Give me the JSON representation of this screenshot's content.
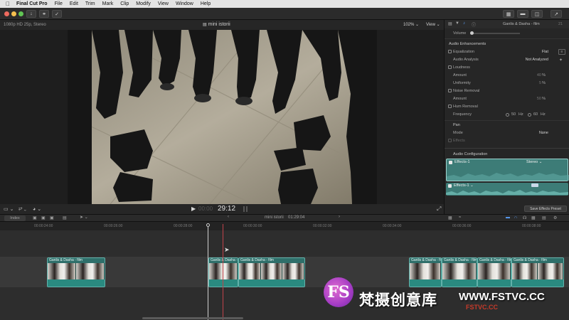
{
  "menubar": {
    "apple": "",
    "items": [
      "Final Cut Pro",
      "File",
      "Edit",
      "Trim",
      "Mark",
      "Clip",
      "Modify",
      "View",
      "Window",
      "Help"
    ]
  },
  "viewer": {
    "format": "1080p HD 25p, Stereo",
    "title": "mini istorii",
    "zoom": "102%",
    "view_label": "View",
    "timecode": "29:12",
    "timecode_prefix": "00:00"
  },
  "inspector": {
    "clip_title": "Ganlis & Dasha - film",
    "clip_duration": "21",
    "volume_label": "Volume",
    "audio_enhancements": "Audio Enhancements",
    "equalization": {
      "label": "Equalization",
      "value": "Flat"
    },
    "audio_analysis": {
      "label": "Audio Analysis",
      "value": "Not Analyzed"
    },
    "loudness": "Loudness",
    "amount": {
      "label": "Amount",
      "value": "40",
      "unit": "%"
    },
    "uniformity": {
      "label": "Uniformity",
      "value": "5",
      "unit": "%"
    },
    "noise_removal": "Noise Removal",
    "noise_amount": {
      "label": "Amount",
      "value": "50",
      "unit": "%"
    },
    "hum_removal": "Hum Removal",
    "frequency": {
      "label": "Frequency",
      "opt1": "50",
      "opt2": "60",
      "unit": "Hz"
    },
    "pan": "Pan",
    "mode": {
      "label": "Mode",
      "value": "None"
    },
    "effects": "Effects",
    "audio_config": "Audio Configuration",
    "config_row1": {
      "label": "Effects-1",
      "value": "Stereo"
    },
    "config_row2": {
      "label": "Effects-1"
    },
    "save_preset": "Save Effects Preset"
  },
  "timeline": {
    "index_label": "Index",
    "project": "mini istorii",
    "duration": "01:29:04",
    "ruler": [
      "00:00:24:00",
      "00:00:26:00",
      "00:00:28:00",
      "00:00:30:00",
      "00:00:32:00",
      "00:00:34:00",
      "00:00:36:00",
      "00:00:38:00"
    ],
    "clip_name": "Ganlis & Dasha - film"
  },
  "watermark": {
    "logo": "FS",
    "text": "梵摄创意库",
    "url": "WWW.FSTVC.CC",
    "small": "FSTVC.CC"
  },
  "colors": {
    "accent": "#61b1aa",
    "clip_fill": "#2f6f6a",
    "audio_config": "#3d7c77"
  }
}
